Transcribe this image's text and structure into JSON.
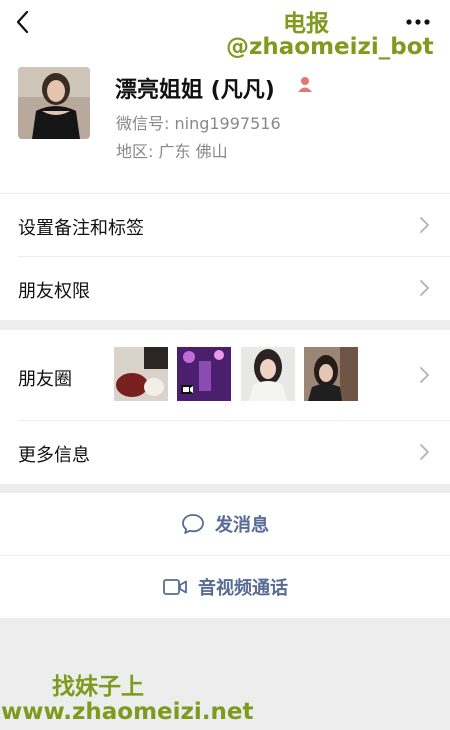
{
  "header": {
    "back_icon": "chevron-left-icon",
    "more_icon": "more-dots-icon"
  },
  "watermarks": {
    "top_line1": "电报",
    "top_line2": "@zhaomeizi_bot",
    "bottom_line1": "找妹子上",
    "bottom_line2": "www.zhaomeizi.net",
    "color": "#7f9a1c"
  },
  "profile": {
    "name": "漂亮姐姐 (凡凡)",
    "gender_icon": "female-icon",
    "wechat_id": "微信号: ning1997516",
    "region": "地区:  广东  佛山"
  },
  "menu": {
    "remarks_label": "设置备注和标签",
    "permissions_label": "朋友权限",
    "moments_label": "朋友圈",
    "more_info_label": "更多信息"
  },
  "actions": {
    "message_label": "发消息",
    "call_label": "音视频通话",
    "accent_color": "#576b95"
  },
  "moments_thumbnails": [
    "moments-photo-food",
    "moments-video-concert",
    "moments-selfie-white",
    "moments-selfie-dark"
  ]
}
